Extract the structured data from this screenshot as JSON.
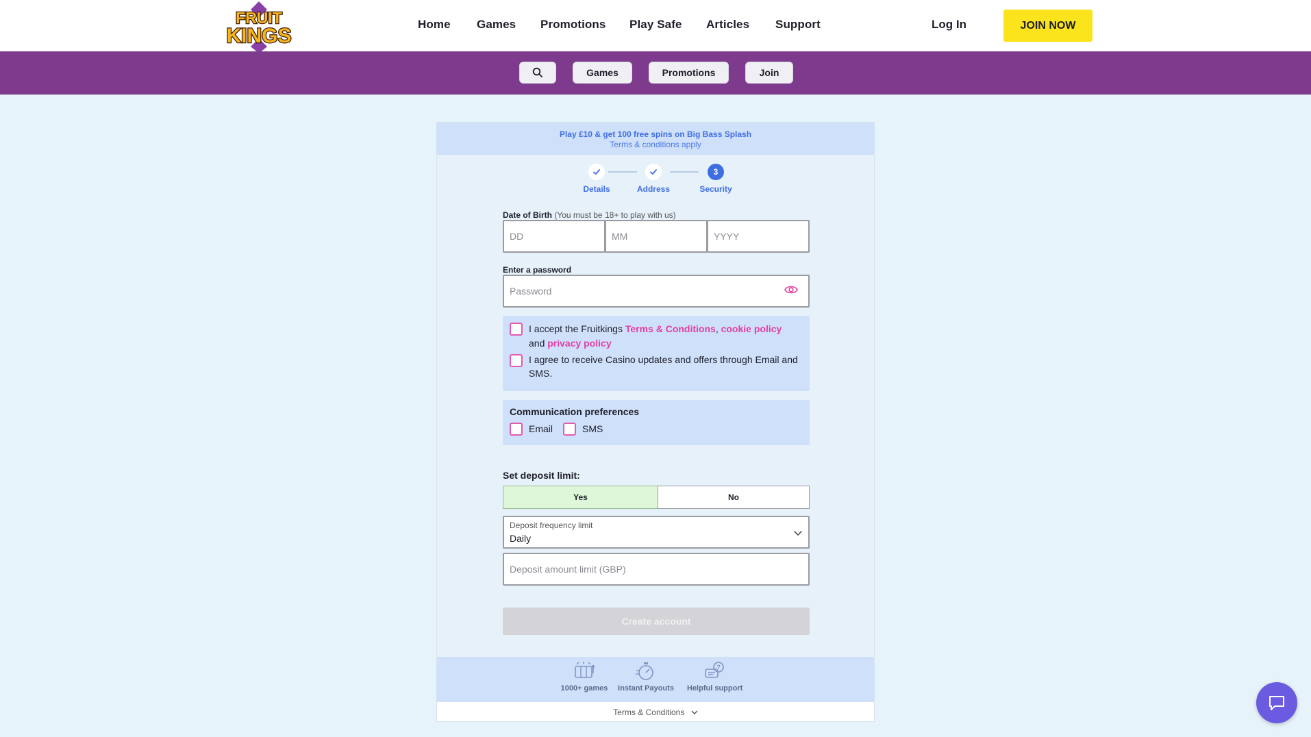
{
  "brand": {
    "logo_line1": "FRUIT",
    "logo_line2": "KINGS"
  },
  "nav": {
    "items": [
      "Home",
      "Games",
      "Promotions",
      "Play Safe",
      "Articles",
      "Support"
    ],
    "login": "Log In",
    "join": "JOIN NOW"
  },
  "subnav": {
    "items": [
      "Games",
      "Promotions",
      "Join"
    ]
  },
  "promo": {
    "title": "Play £10 & get 100 free spins on Big Bass Splash",
    "sub": "Terms & conditions apply"
  },
  "steps": [
    {
      "label": "Details",
      "state": "done"
    },
    {
      "label": "Address",
      "state": "done"
    },
    {
      "label": "Security",
      "state": "current",
      "number": "3"
    }
  ],
  "dob": {
    "label": "Date of Birth",
    "hint": "(You must be 18+ to play with us)",
    "day_placeholder": "DD",
    "month_placeholder": "MM",
    "year_placeholder": "YYYY"
  },
  "password": {
    "label": "Enter a password",
    "placeholder": "Password"
  },
  "terms": {
    "accept_prefix": "I accept the Fruitkings ",
    "terms_link": "Terms & Conditions",
    "comma": ", ",
    "cookie_link": "cookie policy",
    "and_text": " and ",
    "privacy_link": "privacy policy",
    "marketing": "I agree to receive Casino updates and offers through Email and SMS."
  },
  "communication": {
    "title": "Communication preferences",
    "email": "Email",
    "sms": "SMS"
  },
  "deposit": {
    "title": "Set deposit limit:",
    "yes": "Yes",
    "no": "No",
    "selected": "Yes",
    "frequency_label": "Deposit frequency limit",
    "frequency_value": "Daily",
    "amount_placeholder": "Deposit amount limit (GBP)"
  },
  "create_button": "Create account",
  "features": [
    "1000+ games",
    "Instant Payouts",
    "Helpful support"
  ],
  "footer": {
    "terms": "Terms & Conditions"
  },
  "colors": {
    "accent_blue": "#3f6ee3",
    "brand_purple": "#7e3b8d",
    "join_yellow": "#fbe41c",
    "link_pink": "#e23ea4"
  },
  "icons": {
    "search": "search-icon",
    "eye": "eye-icon",
    "chevron": "chevron-down-icon",
    "chat": "chat-icon",
    "check": "check-icon"
  }
}
